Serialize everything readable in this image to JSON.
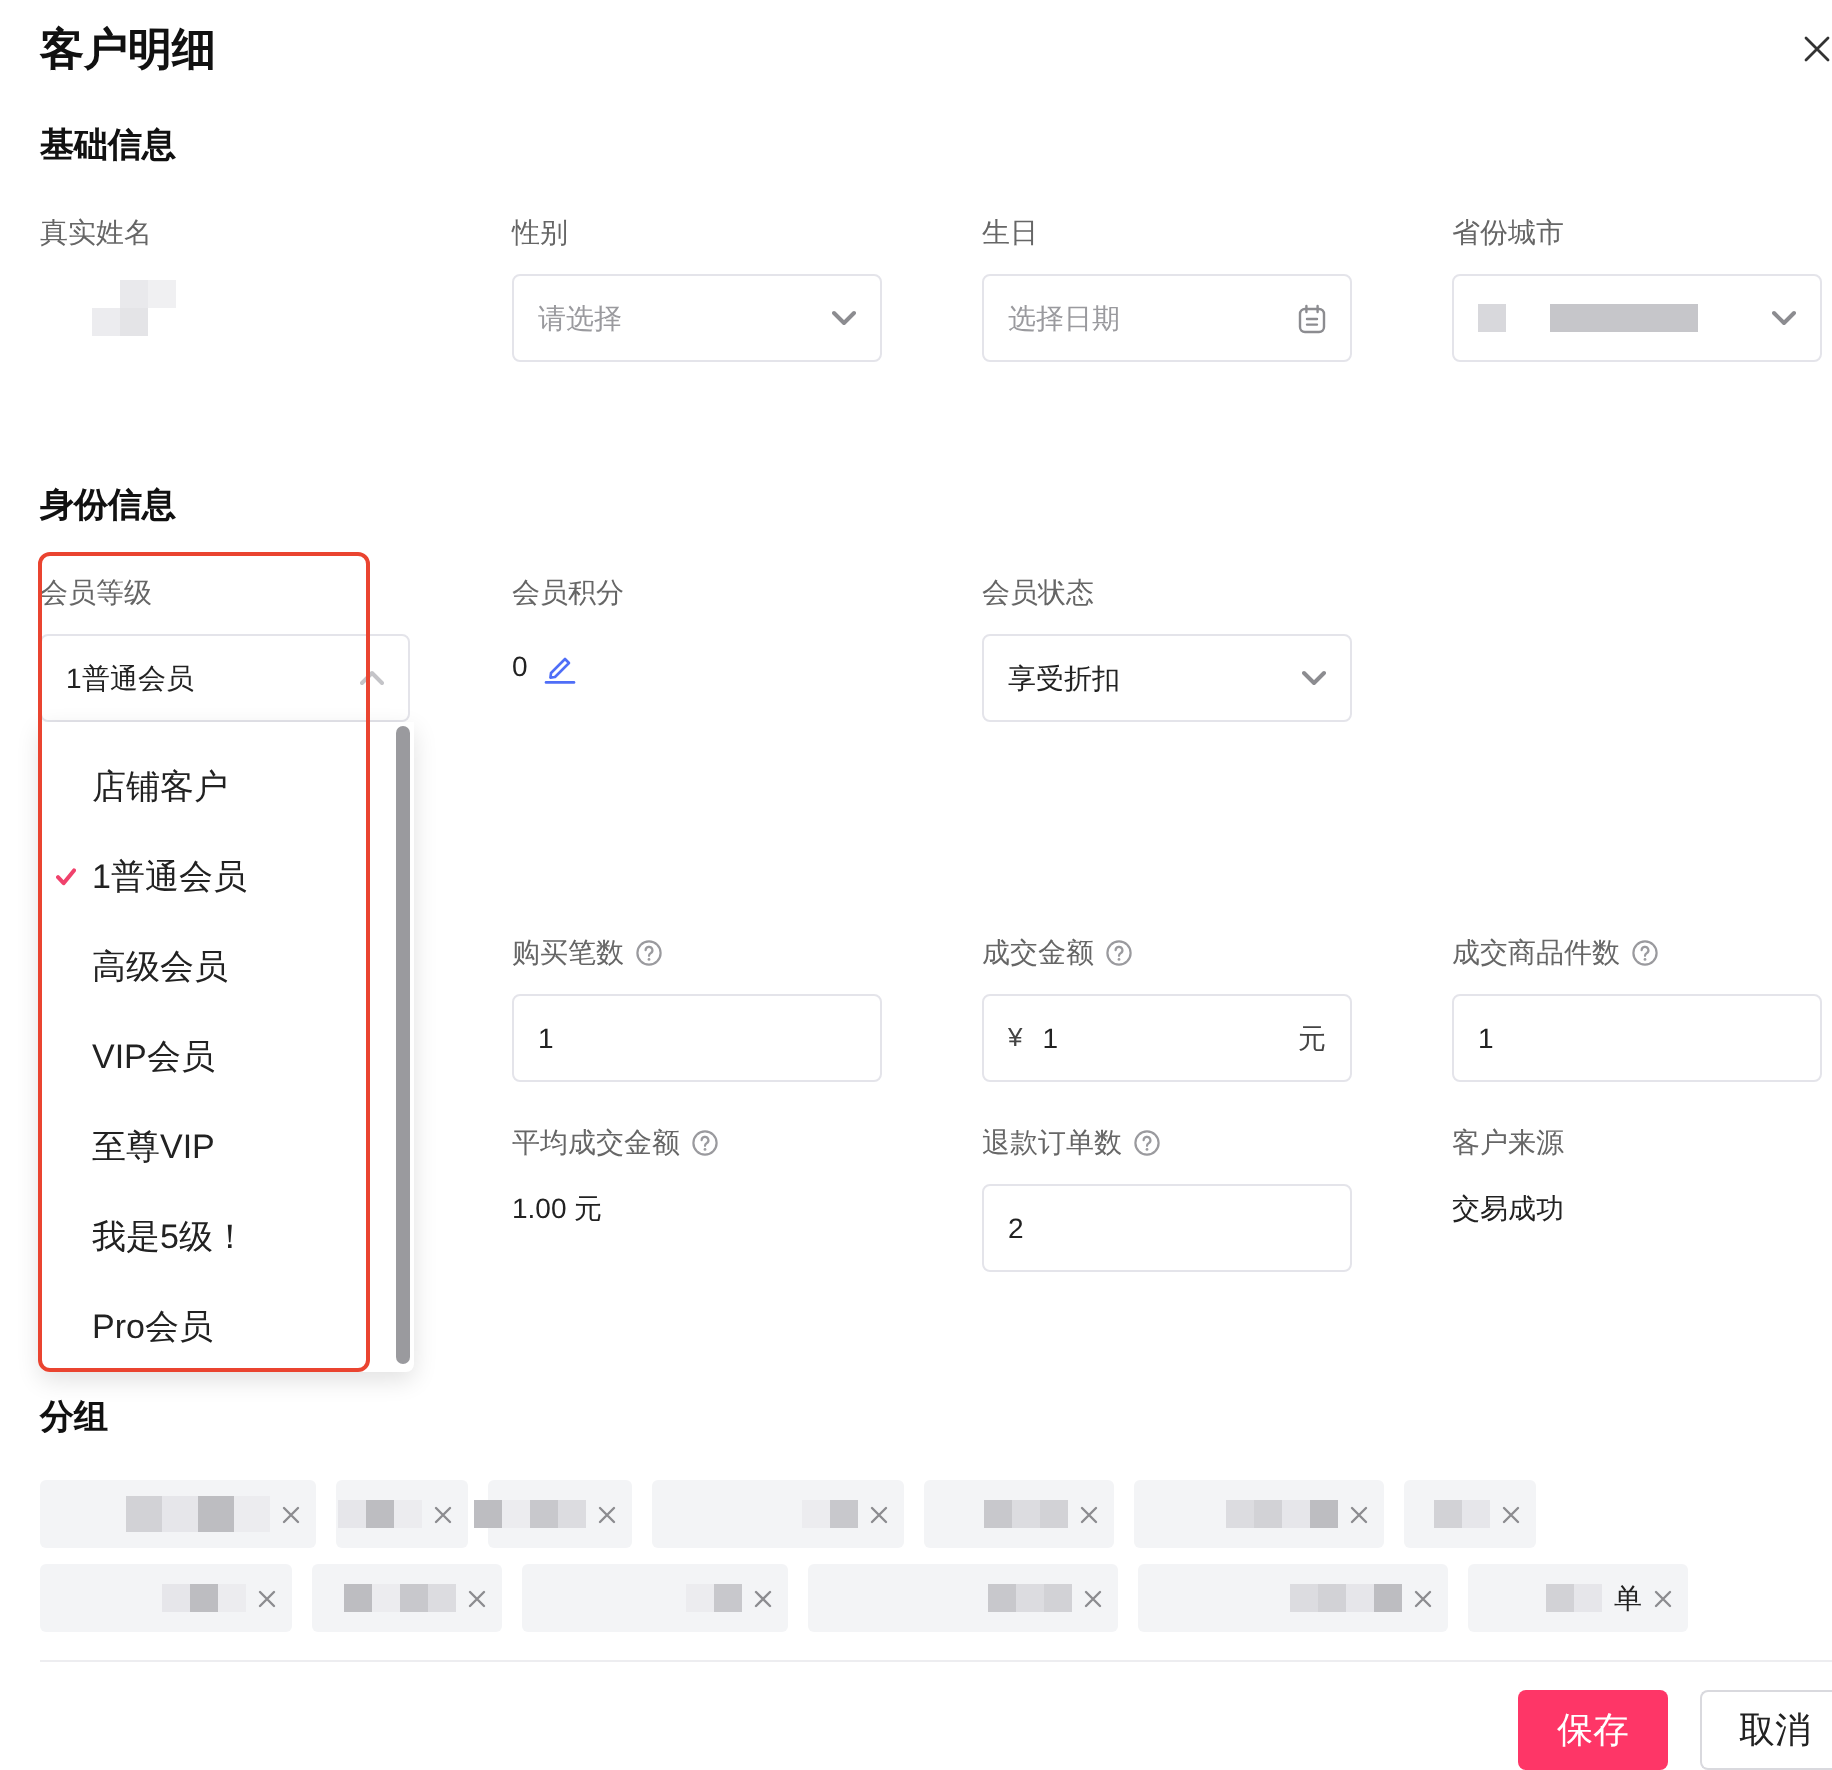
{
  "window": {
    "title": "客户明细"
  },
  "basic_info": {
    "title": "基础信息",
    "fields": [
      {
        "kind": "redacted",
        "label": "真实姓名"
      },
      {
        "kind": "select",
        "label": "性别",
        "placeholder": "请选择",
        "expanded": false
      },
      {
        "kind": "date",
        "label": "生日",
        "placeholder": "选择日期"
      },
      {
        "kind": "redacted_select",
        "label": "省份城市",
        "expanded": false
      }
    ]
  },
  "identity_info": {
    "title": "身份信息",
    "fields": [
      {
        "kind": "select",
        "label": "会员等级",
        "value": "1普通会员",
        "expanded": true,
        "highlighted": true,
        "options": [
          {
            "label": "店铺客户",
            "selected": false
          },
          {
            "label": "1普通会员",
            "selected": true
          },
          {
            "label": "高级会员",
            "selected": false
          },
          {
            "label": "VIP会员",
            "selected": false
          },
          {
            "label": "至尊VIP",
            "selected": false
          },
          {
            "label": "我是5级！",
            "selected": false
          },
          {
            "label": "Pro会员",
            "selected": false
          }
        ]
      },
      {
        "kind": "editable",
        "label": "会员积分",
        "value": "0",
        "highlighted": false
      },
      {
        "kind": "select",
        "label": "会员状态",
        "value": "享受折扣",
        "expanded": false,
        "highlighted": false
      }
    ],
    "stats": [
      {
        "kind": "input",
        "label": "购买笔数",
        "help": true,
        "value": "1"
      },
      {
        "kind": "input",
        "label": "成交金额",
        "help": true,
        "prefix": "¥",
        "value": "1",
        "suffix": "元"
      },
      {
        "kind": "input",
        "label": "成交商品件数",
        "help": true,
        "value": "1"
      },
      {
        "kind": "text",
        "label": "平均成交金额",
        "help": true,
        "value": "1.00 元"
      },
      {
        "kind": "input",
        "label": "退款订单数",
        "help": true,
        "value": "2"
      },
      {
        "kind": "text",
        "label": "客户来源",
        "help": false,
        "value": "交易成功"
      }
    ]
  },
  "groups": {
    "title": "分组",
    "tags": [
      {
        "redacted": true,
        "closable": true
      },
      {
        "redacted": true,
        "closable": true
      },
      {
        "redacted": true,
        "closable": true
      },
      {
        "redacted": true,
        "closable": true
      },
      {
        "redacted": true,
        "closable": true
      },
      {
        "redacted": true,
        "closable": true
      },
      {
        "redacted": true,
        "closable": true
      },
      {
        "redacted": true,
        "closable": true
      },
      {
        "redacted": true,
        "closable": true
      },
      {
        "redacted": true,
        "closable": true
      },
      {
        "redacted": true,
        "closable": true
      },
      {
        "redacted": true,
        "closable": true
      },
      {
        "redacted": true,
        "label": "单",
        "closable": true
      }
    ]
  },
  "buttons": [
    {
      "kind": "primary",
      "label": "保存"
    },
    {
      "kind": "default",
      "label": "取消"
    }
  ]
}
